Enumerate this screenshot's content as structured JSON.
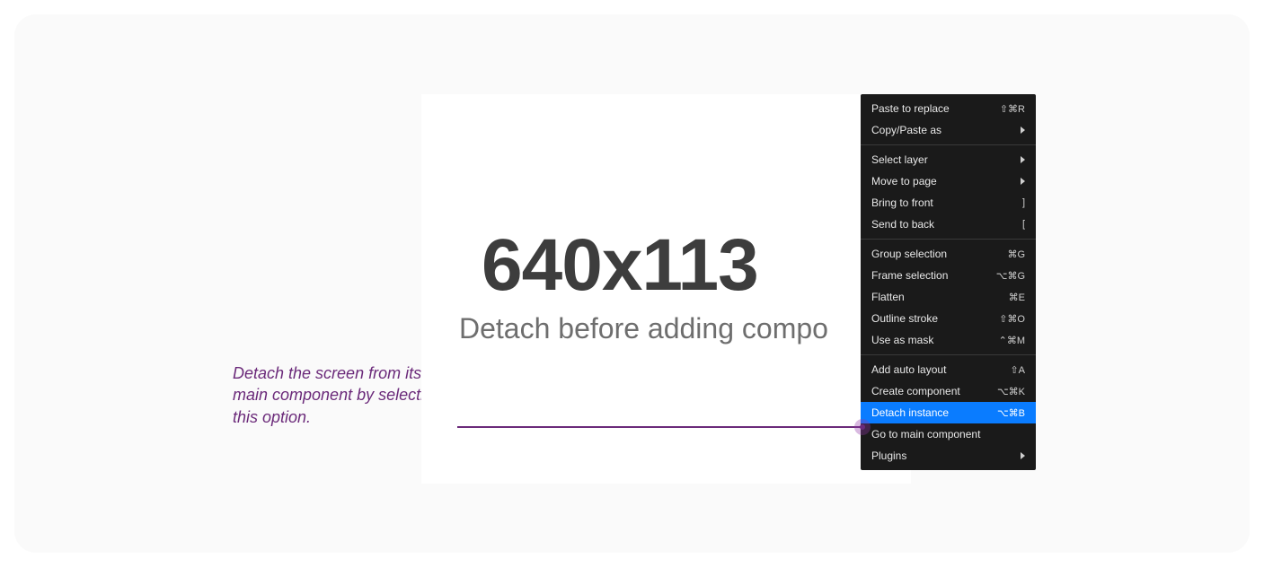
{
  "caption": "Detach the screen from its main component by selecting this option.",
  "canvas": {
    "big_text": "640x113",
    "sub_text": "Detach before adding compo"
  },
  "menu": {
    "groups": [
      [
        {
          "label": "Paste to replace",
          "shortcut": "⇧⌘R",
          "submenu": false,
          "highlight": false
        },
        {
          "label": "Copy/Paste as",
          "shortcut": "",
          "submenu": true,
          "highlight": false
        }
      ],
      [
        {
          "label": "Select layer",
          "shortcut": "",
          "submenu": true,
          "highlight": false
        },
        {
          "label": "Move to page",
          "shortcut": "",
          "submenu": true,
          "highlight": false
        },
        {
          "label": "Bring to front",
          "shortcut": "]",
          "submenu": false,
          "highlight": false
        },
        {
          "label": "Send to back",
          "shortcut": "[",
          "submenu": false,
          "highlight": false
        }
      ],
      [
        {
          "label": "Group selection",
          "shortcut": "⌘G",
          "submenu": false,
          "highlight": false
        },
        {
          "label": "Frame selection",
          "shortcut": "⌥⌘G",
          "submenu": false,
          "highlight": false
        },
        {
          "label": "Flatten",
          "shortcut": "⌘E",
          "submenu": false,
          "highlight": false
        },
        {
          "label": "Outline stroke",
          "shortcut": "⇧⌘O",
          "submenu": false,
          "highlight": false
        },
        {
          "label": "Use as mask",
          "shortcut": "⌃⌘M",
          "submenu": false,
          "highlight": false
        }
      ],
      [
        {
          "label": "Add auto layout",
          "shortcut": "⇧A",
          "submenu": false,
          "highlight": false
        },
        {
          "label": "Create component",
          "shortcut": "⌥⌘K",
          "submenu": false,
          "highlight": false
        },
        {
          "label": "Detach instance",
          "shortcut": "⌥⌘B",
          "submenu": false,
          "highlight": true
        },
        {
          "label": "Go to main component",
          "shortcut": "",
          "submenu": false,
          "highlight": false
        },
        {
          "label": "Plugins",
          "shortcut": "",
          "submenu": true,
          "highlight": false
        }
      ]
    ]
  }
}
